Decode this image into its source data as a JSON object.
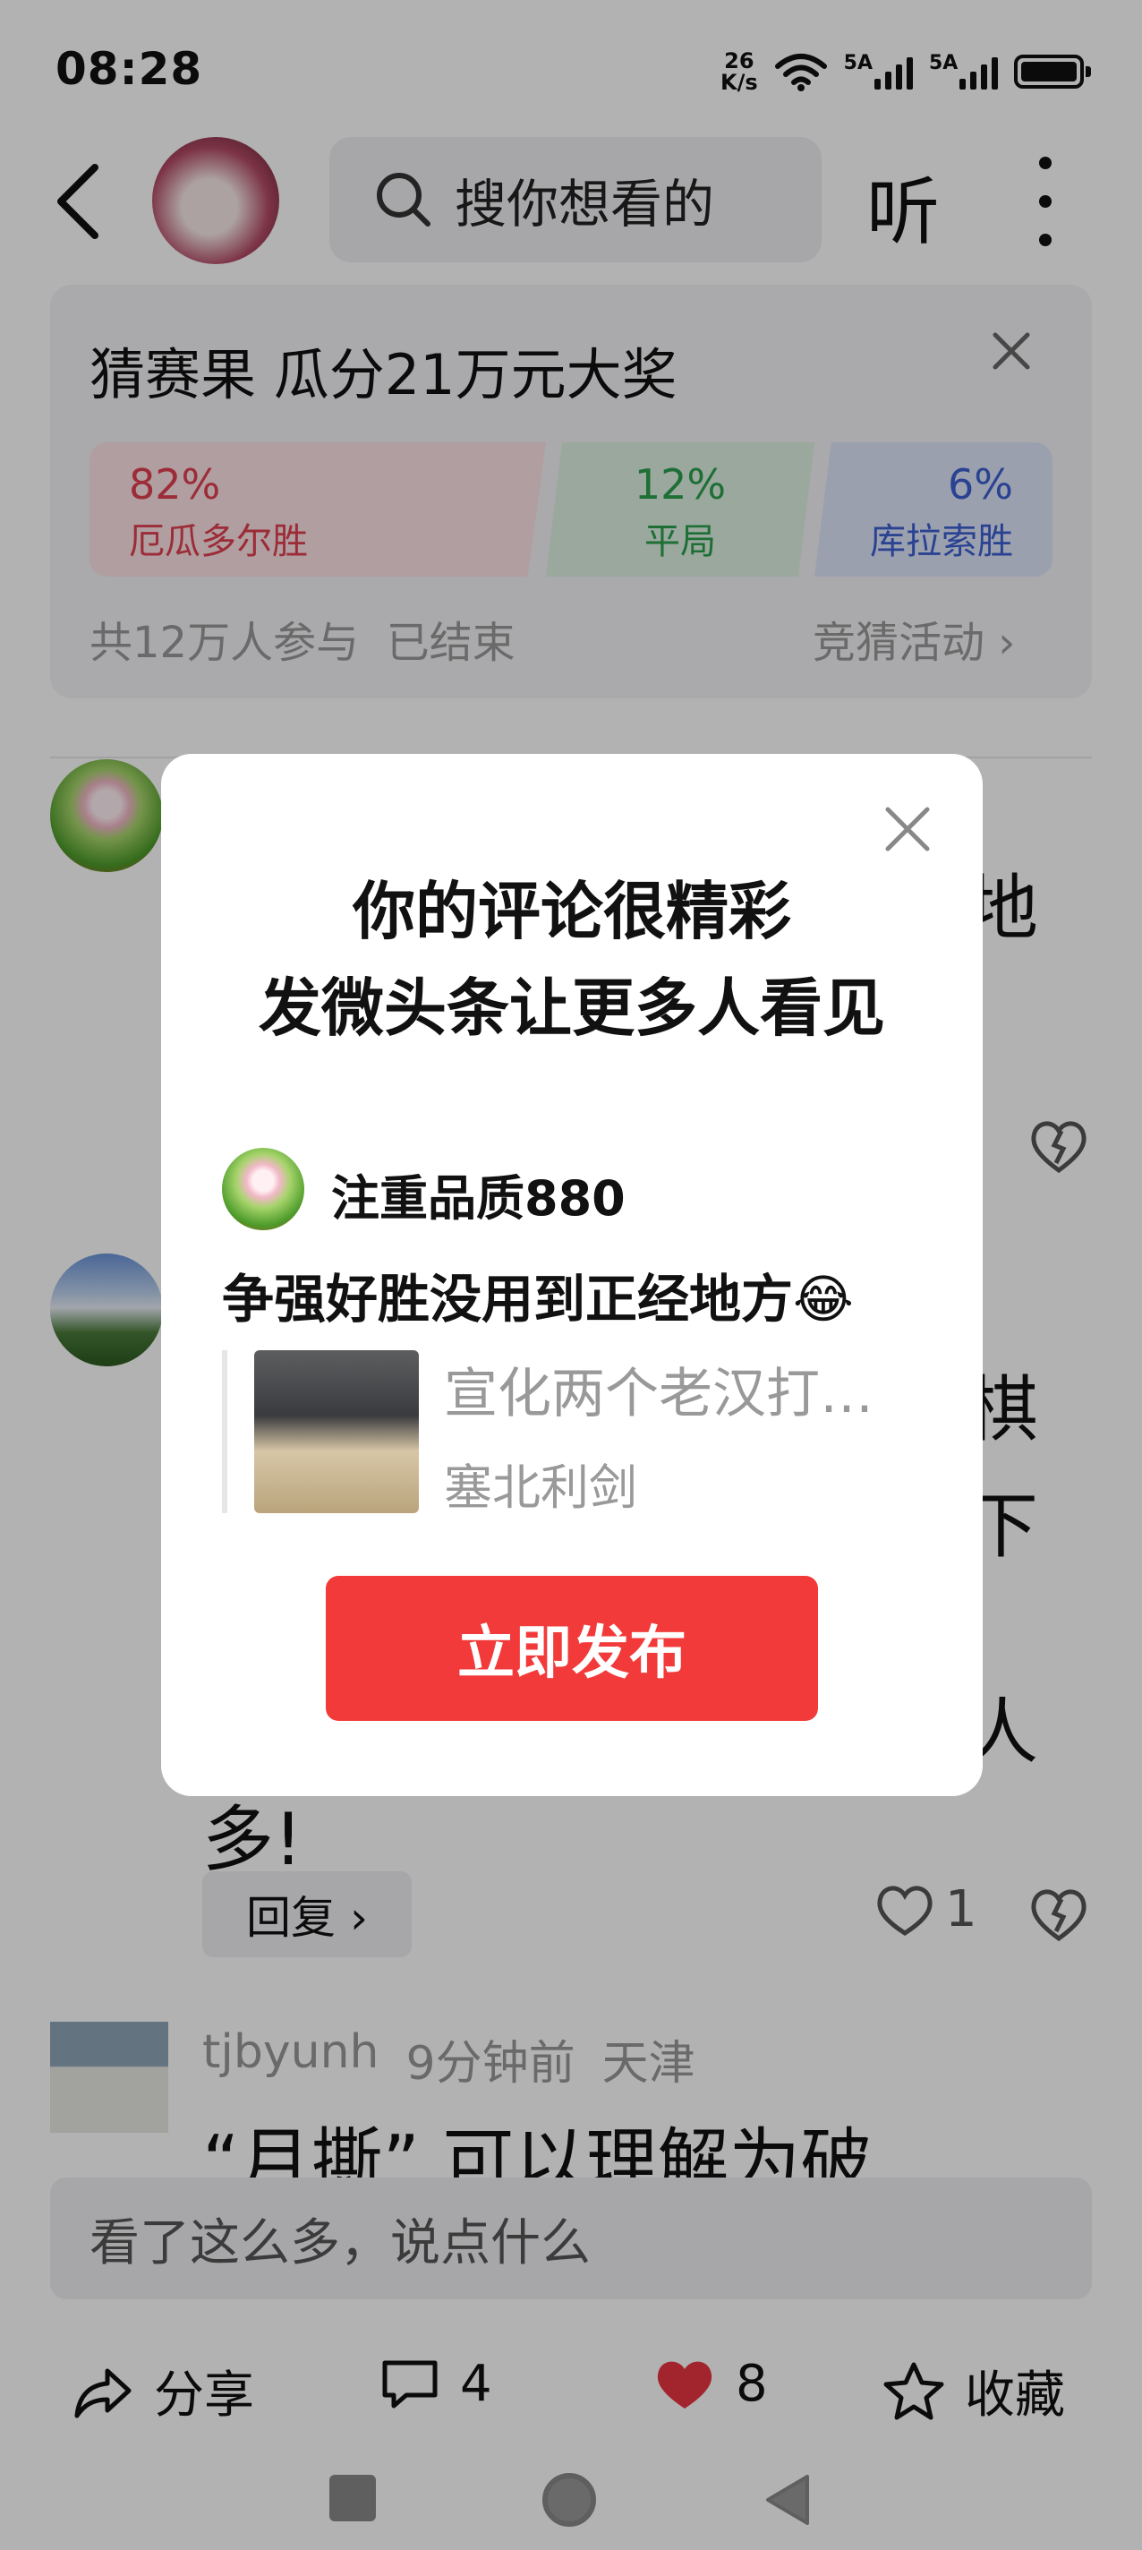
{
  "status_bar": {
    "time": "08:28",
    "net_speed_value": "26",
    "net_speed_unit": "K/s",
    "sim1_label": "5A",
    "sim2_label": "5A"
  },
  "top_bar": {
    "search_placeholder": "搜你想看的",
    "listen_label": "听"
  },
  "prediction": {
    "title": "猜赛果 瓜分21万元大奖",
    "options": [
      {
        "percent": "82%",
        "label": "厄瓜多尔胜"
      },
      {
        "percent": "12%",
        "label": "平局"
      },
      {
        "percent": "6%",
        "label": "库拉索胜"
      }
    ],
    "meta": "共12万人参与  已结束",
    "link": "竞猜活动 ›"
  },
  "comments_bg": {
    "frag_1": "地",
    "frag_2a": "棋",
    "frag_2b": "下",
    "frag_2c": "人",
    "frag_2d": "多!",
    "reply_label": "回复 ›",
    "like_count": "1",
    "third": {
      "username": "tjbyunh",
      "time": "9分钟前",
      "location": "天津",
      "text": "“月撕” 可以理解为破"
    }
  },
  "comment_input_placeholder": "看了这么多，说点什么",
  "bottom_bar": {
    "share_label": "分享",
    "comment_count": "4",
    "like_count": "8",
    "favorite_label": "收藏"
  },
  "dialog": {
    "title_line1": "你的评论很精彩",
    "title_line2": "发微头条让更多人看见",
    "username": "注重品质880",
    "comment": "争强好胜没用到正经地方😂",
    "article_title": "宣化两个老汉打…",
    "article_source": "塞北利剑",
    "publish_label": "立即发布"
  }
}
